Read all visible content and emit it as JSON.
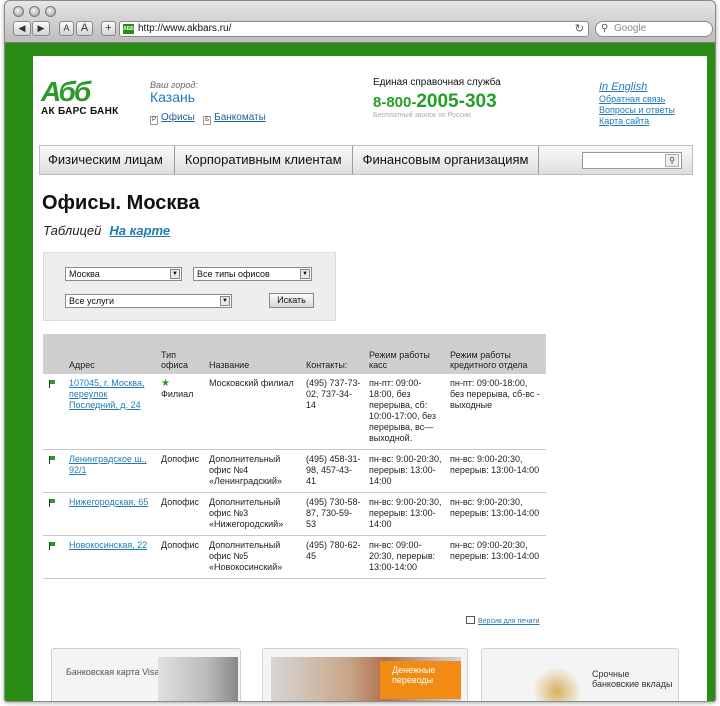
{
  "browser": {
    "url": "http://www.akbars.ru/",
    "search_placeholder": "Google",
    "back": "◀",
    "forward": "▶",
    "font_small": "A",
    "font_large": "A",
    "add": "+",
    "reload": "↻",
    "favicon": "AББ"
  },
  "header": {
    "logo_mark": "Абб",
    "logo_name": "АК БАРС БАНК",
    "city_label": "Ваш город:",
    "city": "Казань",
    "links": [
      {
        "icon": "Р",
        "label": "Офисы"
      },
      {
        "icon": "Б",
        "label": "Банкоматы"
      }
    ],
    "service_label": "Единая справочная служба",
    "phone_prefix": "8-800-",
    "phone_main": "2005-303",
    "phone_note": "Бесплатный звонок по России",
    "right_links": [
      "In English",
      "Обратная связь",
      "Вопросы и ответы",
      "Карта сайта"
    ]
  },
  "menu": {
    "items": [
      "Физическим лицам",
      "Корпоративным клиентам",
      "Финансовым организациям"
    ],
    "search_value": ""
  },
  "page": {
    "title": "Офисы. Москва",
    "tab_table": "Таблицей",
    "tab_map": "На карте"
  },
  "filter": {
    "city": "Москва",
    "office_type": "Все типы офисов",
    "services": "Все услуги",
    "submit": "Искать"
  },
  "table": {
    "headers": [
      "Адрес",
      "Тип офиса",
      "Название",
      "Контакты:",
      "Режим работы касс",
      "Режим работы кредитного отдела"
    ],
    "rows": [
      {
        "address": "107045, г. Москва, переулок Последний, д. 24",
        "type": "Филиал",
        "star": "★",
        "name": "Московский филиал",
        "contacts": "(495) 737-73-02, 737-34-14",
        "cash": "пн-пт: 09:00-18:00, без перерыва, сб: 10:00-17:00, без перерыва, вс—выходной.",
        "credit": "пн-пт: 09:00-18:00, без перерыва, сб-вс - выходные"
      },
      {
        "address": "Ленинградское ш., 92/1",
        "type": "Допофис",
        "star": "",
        "name": "Дополнительный офис №4 «Ленинградский»",
        "contacts": "(495) 458-31-98, 457-43-41",
        "cash": "пн-вс: 9:00-20:30, перерыв: 13:00-14:00",
        "credit": "пн-вс: 9:00-20:30, перерыв: 13:00-14:00"
      },
      {
        "address": "Нижегородская, 65",
        "type": "Допофис",
        "star": "",
        "name": "Дополнительный офис №3 «Нижегородский»",
        "contacts": "(495) 730-58-87, 730-59-53",
        "cash": "пн-вс: 9:00-20:30, перерыв: 13:00-14:00",
        "credit": "пн-вс: 9:00-20:30, перерыв: 13:00-14:00"
      },
      {
        "address": "Новокосинская, 22",
        "type": "Допофис",
        "star": "",
        "name": "Дополнительный офис №5 «Новокосинский»",
        "contacts": "(495) 780-62-45",
        "cash": "пн-вс: 09:00-20:30, перерыв: 13:00-14:00",
        "credit": "пн-вс: 09:00-20:30, перерыв: 13:00-14:00"
      }
    ]
  },
  "print_link": "Версия для печати",
  "promos": {
    "p1": "Банковская карта Visa Platinum",
    "p2": "Денежные переводы",
    "p3": "Срочные банковские вклады"
  },
  "colors": {
    "brand_green": "#2a8c15",
    "link_blue": "#1f7ab8",
    "phone_green": "#22a022",
    "promo_orange": "#f08c14"
  }
}
